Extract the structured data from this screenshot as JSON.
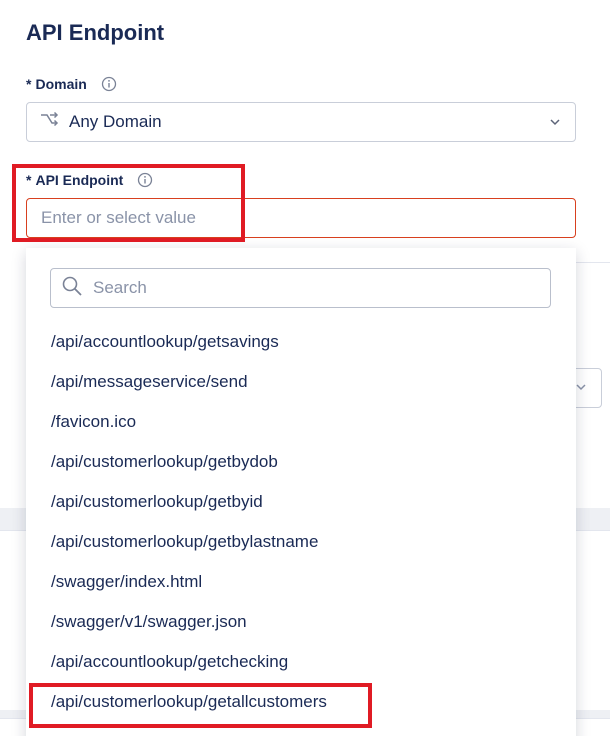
{
  "title": "API Endpoint",
  "domain": {
    "required_mark": "*",
    "label": "Domain",
    "value": "Any Domain"
  },
  "endpoint": {
    "required_mark": "*",
    "label": "API Endpoint",
    "placeholder": "Enter or select value"
  },
  "dropdown": {
    "search_placeholder": "Search",
    "options": [
      "/api/accountlookup/getsavings",
      "/api/messageservice/send",
      "/favicon.ico",
      "/api/customerlookup/getbydob",
      "/api/customerlookup/getbyid",
      "/api/customerlookup/getbylastname",
      "/swagger/index.html",
      "/swagger/v1/swagger.json",
      "/api/accountlookup/getchecking",
      "/api/customerlookup/getallcustomers"
    ]
  },
  "colors": {
    "text": "#1a2a55",
    "error_border": "#d8401f",
    "annotation_red": "#e01b24"
  },
  "icons": [
    "info-icon",
    "split-arrows-icon",
    "chevron-down-icon",
    "search-icon"
  ]
}
